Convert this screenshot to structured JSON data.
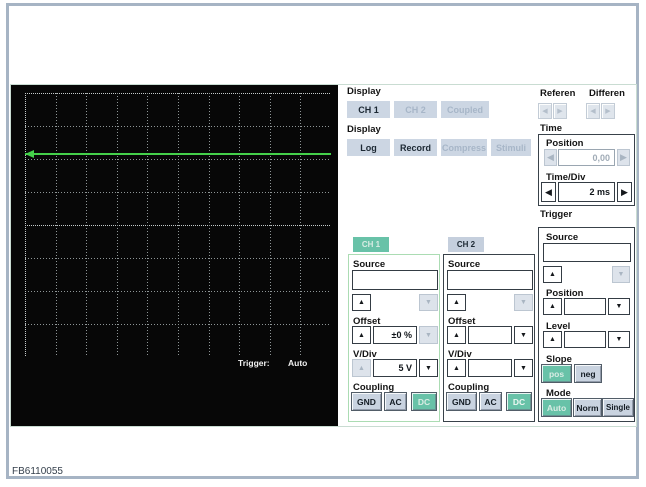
{
  "icons": {
    "up": "▲",
    "down": "▼",
    "left": "◀",
    "right": "▶"
  },
  "colors": {
    "teal": "#68c2a8",
    "panel_button": "#ccd6e3",
    "trace_green": "#44d04a",
    "frame": "#a6b4c4"
  },
  "footer": {
    "code": "FB6110055"
  },
  "scope": {
    "trigger_label": "Trigger:",
    "trigger_value": "Auto"
  },
  "display_section": {
    "label": "Display",
    "channels": [
      {
        "label": "CH 1"
      },
      {
        "label": "CH 2"
      },
      {
        "label": "Coupled"
      }
    ],
    "label2": "Display",
    "modes": [
      {
        "label": "Log"
      },
      {
        "label": "Record"
      },
      {
        "label": "Compress"
      },
      {
        "label": "Stimuli"
      }
    ]
  },
  "reference_section": {
    "reference_label": "Referen",
    "difference_label": "Differen"
  },
  "time_section": {
    "title": "Time",
    "position_label": "Position",
    "position_value": "0,00",
    "timediv_label": "Time/Div",
    "timediv_value": "2 ms"
  },
  "trigger_section": {
    "title": "Trigger",
    "source_label": "Source",
    "source_value": "",
    "position_label": "Position",
    "position_value": "",
    "level_label": "Level",
    "level_value": "",
    "slope_label": "Slope",
    "slope_pos": "pos",
    "slope_neg": "neg",
    "mode_label": "Mode",
    "mode_auto": "Auto",
    "mode_norm": "Norm",
    "mode_single": "Single"
  },
  "ch1": {
    "tab": "CH 1",
    "source_label": "Source",
    "source_value": "",
    "offset_label": "Offset",
    "offset_value": "±0 %",
    "vdiv_label": "V/Div",
    "vdiv_value": "5 V",
    "coupling_label": "Coupling",
    "gnd": "GND",
    "ac": "AC",
    "dc": "DC"
  },
  "ch2": {
    "tab": "CH 2",
    "source_label": "Source",
    "source_value": "",
    "offset_label": "Offset",
    "offset_value": "",
    "vdiv_label": "V/Div",
    "vdiv_value": "",
    "coupling_label": "Coupling",
    "gnd": "GND",
    "ac": "AC",
    "dc": "DC"
  }
}
